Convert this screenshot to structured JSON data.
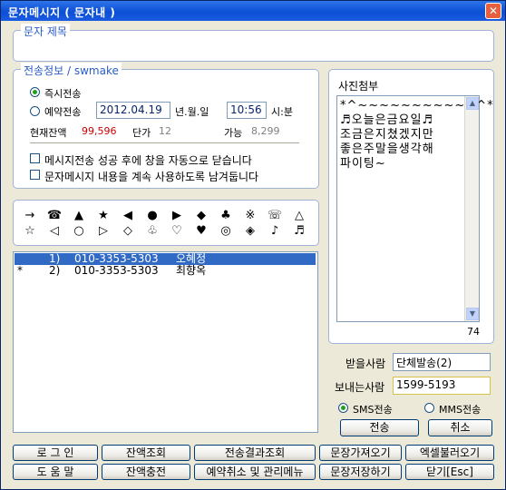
{
  "window": {
    "title": "문자메시지 ( 문자내 )",
    "close_glyph": "✕"
  },
  "subject": {
    "legend": "문자 제목",
    "value": ""
  },
  "send_info": {
    "legend": "전송정보 / swmake",
    "immediate_label": "즉시전송",
    "reserve_label": "예약전송",
    "date": "2012.04.19",
    "date_suffix": "년.월.일",
    "time": "10:56",
    "time_suffix": "시:분",
    "balance_label": "현재잔액",
    "balance_value": "99,596",
    "unit_price_label": "단가",
    "unit_price_value": "12",
    "available_label": "가능",
    "available_value": "8,299",
    "auto_close_label": "메시지전송 성공 후에 창을 자동으로 닫습니다",
    "keep_message_label": "문자메시지 내용을 계속 사용하도록 남겨둡니다"
  },
  "symbols": {
    "row1": [
      "→",
      "☎",
      "▲",
      "★",
      "◀",
      "●",
      "▶",
      "◆",
      "♣",
      "※",
      "☏",
      "△"
    ],
    "row2": [
      "☆",
      "◁",
      "○",
      "▷",
      "◇",
      "♧",
      "♡",
      "♥",
      "◎",
      "◈",
      "♪",
      "♬"
    ]
  },
  "recipients": [
    {
      "marker": "",
      "index": "1)",
      "phone": "010-3353-5303",
      "name": "오혜정",
      "selected": true
    },
    {
      "marker": "*",
      "index": "2)",
      "phone": "010-3353-5303",
      "name": "최향옥",
      "selected": false
    }
  ],
  "photo": {
    "legend": "사진첨부",
    "lines": [
      "*^~~~~~~~~~~~^*",
      "♬오늘은금요일♬",
      "조금은지쳤겠지만",
      "좋은주말을생각해",
      "파이팅~"
    ],
    "byte_count": "74"
  },
  "receiver": {
    "label": "받을사람",
    "value": "단체발송(2)"
  },
  "sender": {
    "label": "보내는사람",
    "value": "1599-5193"
  },
  "mode": {
    "sms_label": "SMS전송",
    "mms_label": "MMS전송",
    "selected": "SMS"
  },
  "actions": {
    "send": "전송",
    "cancel": "취소"
  },
  "bottom_buttons": {
    "login": "로 그 인",
    "balance_check": "잔액조회",
    "result_check": "전송결과조회",
    "load_message": "문장가져오기",
    "excel_import": "엑셀불러오기",
    "help": "도 움 말",
    "recharge": "잔액충전",
    "reservation": "예약취소 및 관리메뉴",
    "save_message": "문장저장하기",
    "close": "닫기[Esc]"
  },
  "colors": {
    "title_bar": "#0b4fd6",
    "accent_text": "#2a5cc5",
    "balance_value": "#cc0000",
    "selection": "#316ac5",
    "sender_border": "#d4c24a"
  }
}
